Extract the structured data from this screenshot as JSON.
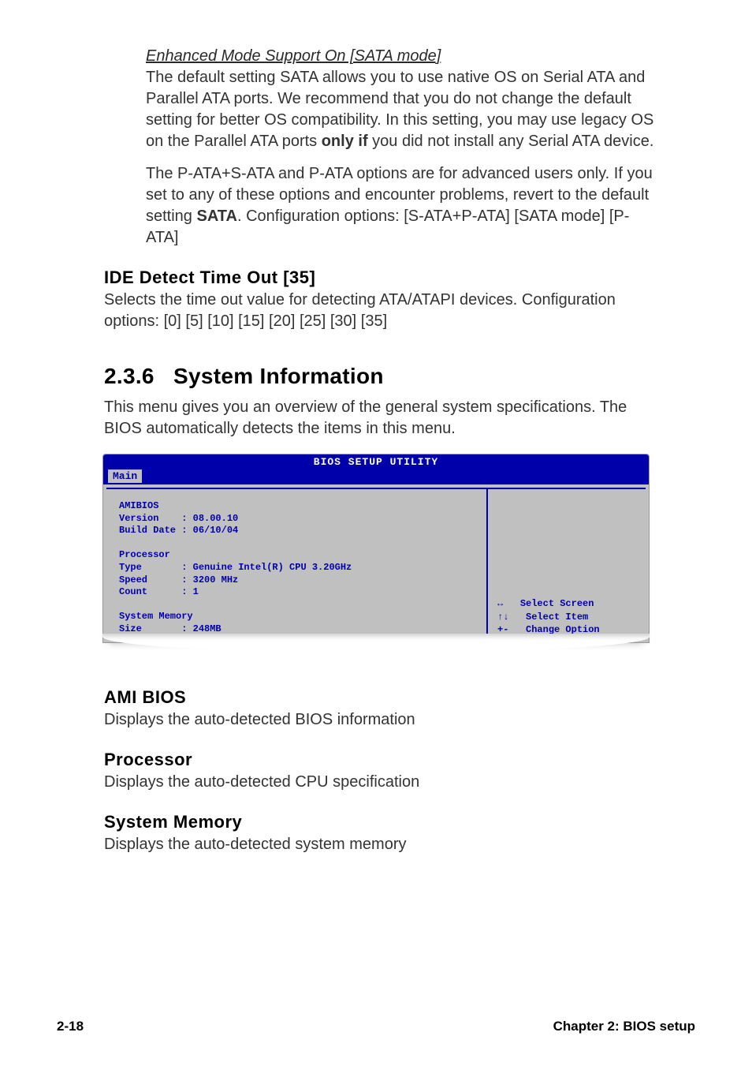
{
  "enhanced_mode": {
    "title": "Enhanced Mode Support On [SATA mode]",
    "p1_a": "The default setting SATA allows you to use native OS on Serial ATA and Parallel ATA ports. We recommend that you do not change the default setting for better OS compatibility. In this setting, you may use legacy OS on the Parallel ATA ports ",
    "p1_bold": "only if",
    "p1_b": " you did not install any Serial ATA device.",
    "p2_a": "The P-ATA+S-ATA and P-ATA options are for advanced users only. If you set to any of these options and encounter problems, revert to the default setting ",
    "p2_bold": "SATA",
    "p2_b": ". Configuration options: [S-ATA+P-ATA] [SATA mode] [P-ATA]"
  },
  "ide_detect": {
    "heading": "IDE Detect Time Out [35]",
    "body": "Selects the time out value for detecting ATA/ATAPI devices. Configuration options: [0] [5] [10] [15] [20] [25] [30] [35]"
  },
  "sysinfo": {
    "heading_num": "2.3.6",
    "heading_text": "System Information",
    "intro": "This menu gives you an overview of the general system specifications. The BIOS automatically detects the items in this menu."
  },
  "bios_screen": {
    "title": "BIOS SETUP UTILITY",
    "tab": "Main",
    "amibios_label": "AMIBIOS",
    "version": "Version    : 08.00.10",
    "build_date": "Build Date : 06/10/04",
    "processor_label": "Processor",
    "cpu_type": "Type       : Genuine Intel(R) CPU 3.20GHz",
    "cpu_speed": "Speed      : 3200 MHz",
    "cpu_count": "Count      : 1",
    "sysmem_label": "System Memory",
    "sysmem_size": "Size       : 248MB",
    "nav_select_screen": "Select Screen",
    "nav_select_item": "Select Item",
    "nav_change_option": "Change Option",
    "arrow_lr": "↔",
    "arrow_ud": "↑↓",
    "plus_minus": "+-"
  },
  "sub": {
    "ami_h": "AMI BIOS",
    "ami_b": "Displays the auto-detected BIOS information",
    "proc_h": "Processor",
    "proc_b": "Displays the auto-detected CPU specification",
    "mem_h": "System Memory",
    "mem_b": "Displays the auto-detected system memory"
  },
  "footer": {
    "left": "2-18",
    "right": "Chapter 2: BIOS setup"
  }
}
